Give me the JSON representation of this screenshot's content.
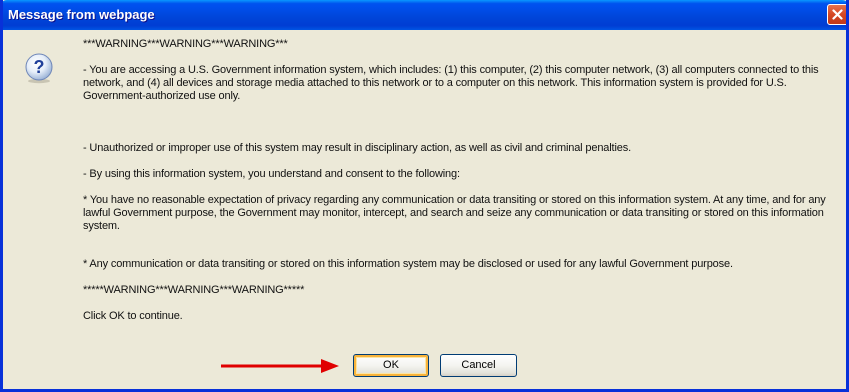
{
  "window": {
    "title": "Message from webpage"
  },
  "dialog": {
    "icon": "question-icon",
    "paragraphs": {
      "warning_header": "***WARNING***WARNING***WARNING***",
      "access": "- You are accessing a U.S. Government information system, which includes: (1) this computer, (2) this computer network, (3) all computers connected to this network, and (4) all devices and storage media attached to this network or to a computer on this network. This information system is provided for U.S. Government-authorized use only.",
      "unauthorized": "- Unauthorized or improper use of this system may result in disciplinary action, as well as civil and criminal penalties.",
      "consent": "- By using this information system, you understand and consent to the following:",
      "privacy": "* You have no reasonable expectation of privacy regarding any communication or data transiting or stored on this information system. At any time, and for any lawful Government purpose, the Government may monitor, intercept, and search and seize any communication or data transiting or stored on this information system.",
      "disclosed": "* Any communication or data transiting or stored on this information system may be disclosed or used for any lawful Government purpose.",
      "warning_footer": "*****WARNING***WARNING***WARNING*****",
      "continue": "Click OK to continue."
    }
  },
  "buttons": {
    "ok_label": "OK",
    "cancel_label": "Cancel"
  },
  "annotation": {
    "arrow_color": "#E00000"
  },
  "colors": {
    "titlebar": "#0053EE",
    "dialog_bg": "#ECE9D8",
    "close_button": "#D54723",
    "default_button_focus": "#F8B33B"
  }
}
